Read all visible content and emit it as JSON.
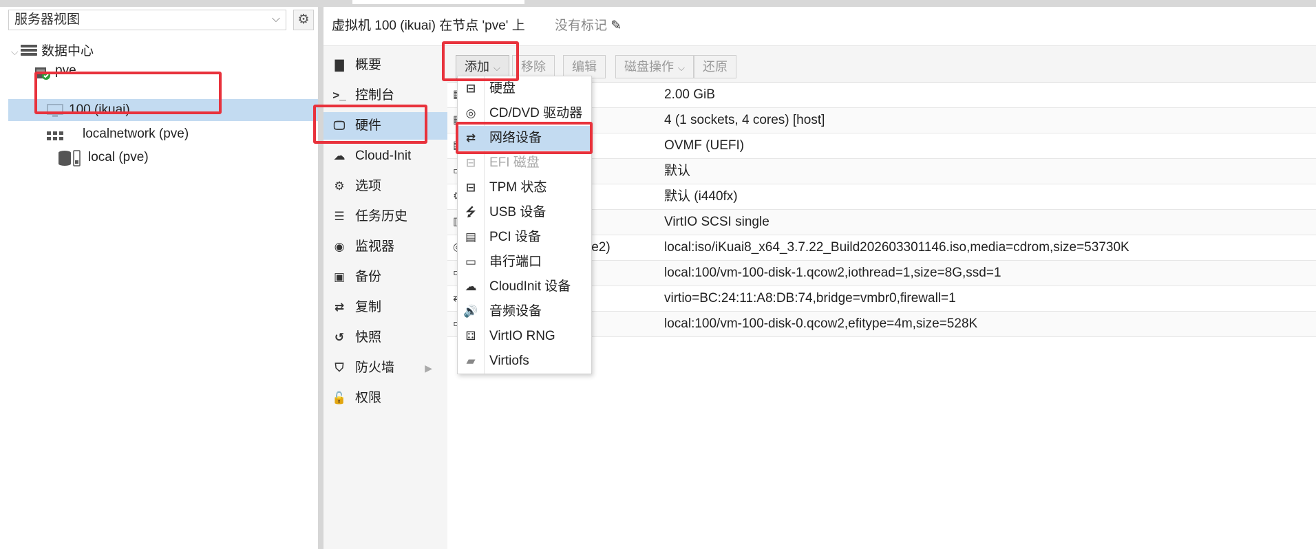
{
  "tree": {
    "view_selector": "服务器视图",
    "items": [
      {
        "label": "数据中心",
        "icon": "datacenter-icon"
      },
      {
        "label": "pve",
        "icon": "node-icon"
      },
      {
        "label": "100 (ikuai)",
        "icon": "vm-icon"
      },
      {
        "label": "localnetwork (pve)",
        "icon": "network-icon"
      },
      {
        "label": "local (pve)",
        "icon": "storage-icon"
      }
    ]
  },
  "header": {
    "title": "虚拟机 100 (ikuai) 在节点 'pve' 上",
    "tags": "没有标记"
  },
  "nav": {
    "items": [
      {
        "label": "概要",
        "icon": "book-icon"
      },
      {
        "label": "控制台",
        "icon": "terminal-icon"
      },
      {
        "label": "硬件",
        "icon": "monitor-icon"
      },
      {
        "label": "Cloud-Init",
        "icon": "cloud-icon"
      },
      {
        "label": "选项",
        "icon": "gear-icon"
      },
      {
        "label": "任务历史",
        "icon": "list-icon"
      },
      {
        "label": "监视器",
        "icon": "eye-icon"
      },
      {
        "label": "备份",
        "icon": "floppy-icon"
      },
      {
        "label": "复制",
        "icon": "retweet-icon"
      },
      {
        "label": "快照",
        "icon": "history-icon"
      },
      {
        "label": "防火墙",
        "icon": "shield-icon"
      },
      {
        "label": "权限",
        "icon": "unlock-icon"
      }
    ]
  },
  "toolbar": {
    "add": "添加",
    "remove": "移除",
    "edit": "编辑",
    "disk_action": "磁盘操作",
    "revert": "还原"
  },
  "hardware": {
    "rows": [
      {
        "key": "",
        "value": "2.00 GiB"
      },
      {
        "key": "",
        "value": "4 (1 sockets, 4 cores) [host]"
      },
      {
        "key": "",
        "value": "OVMF (UEFI)"
      },
      {
        "key": "",
        "value": "默认"
      },
      {
        "key": "",
        "value": "默认 (i440fx)"
      },
      {
        "key": "",
        "value": "VirtIO SCSI single"
      },
      {
        "key": "le2)",
        "value": "local:iso/iKuai8_x64_3.7.22_Build202603301146.iso,media=cdrom,size=53730K"
      },
      {
        "key": "",
        "value": "local:100/vm-100-disk-1.qcow2,iothread=1,size=8G,ssd=1"
      },
      {
        "key": "",
        "value": "virtio=BC:24:11:A8:DB:74,bridge=vmbr0,firewall=1"
      },
      {
        "key": "",
        "value": "local:100/vm-100-disk-0.qcow2,efitype=4m,size=528K"
      }
    ]
  },
  "add_menu": {
    "items": [
      {
        "label": "硬盘",
        "icon": "hdd-icon"
      },
      {
        "label": "CD/DVD 驱动器",
        "icon": "disc-icon"
      },
      {
        "label": "网络设备",
        "icon": "exchange-icon"
      },
      {
        "label": "EFI 磁盘",
        "icon": "hdd-icon"
      },
      {
        "label": "TPM 状态",
        "icon": "hdd-icon"
      },
      {
        "label": "USB 设备",
        "icon": "usb-icon"
      },
      {
        "label": "PCI 设备",
        "icon": "pci-card-icon"
      },
      {
        "label": "串行端口",
        "icon": "serial-port-icon"
      },
      {
        "label": "CloudInit 设备",
        "icon": "cloud-icon"
      },
      {
        "label": "音频设备",
        "icon": "speaker-icon"
      },
      {
        "label": "VirtIO RNG",
        "icon": "dice-icon"
      },
      {
        "label": "Virtiofs",
        "icon": "folder-icon"
      }
    ]
  },
  "colors": {
    "highlight": "#e8323c",
    "selected": "#c3dbf1",
    "status_ok": "#2e9d3a"
  }
}
